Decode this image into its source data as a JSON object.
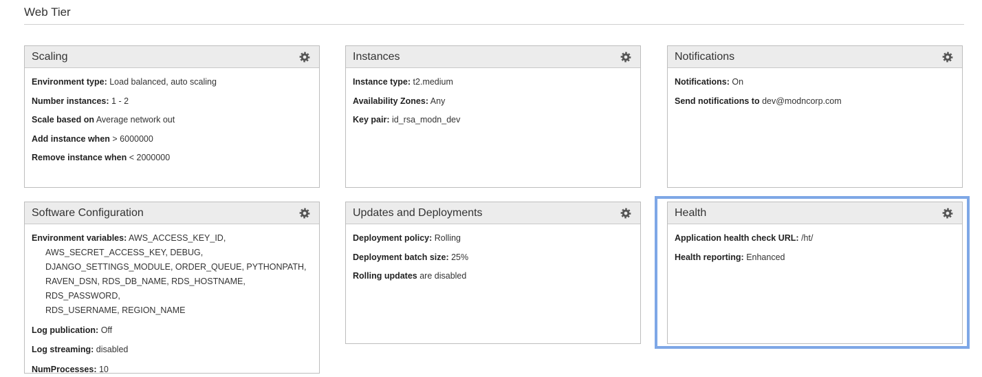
{
  "section": {
    "title": "Web Tier"
  },
  "highlight_color": "#7ea7e6",
  "cards": {
    "scaling": {
      "title": "Scaling",
      "icon": "gear-icon",
      "rows": [
        {
          "label": "Environment type:",
          "value": "Load balanced, auto scaling"
        },
        {
          "label": "Number instances:",
          "value": "1 - 2"
        },
        {
          "label": "Scale based on",
          "value": "Average network out"
        },
        {
          "label": "Add instance when",
          "value": "> 6000000"
        },
        {
          "label": "Remove instance when",
          "value": "< 2000000"
        }
      ]
    },
    "instances": {
      "title": "Instances",
      "icon": "gear-icon",
      "rows": [
        {
          "label": "Instance type:",
          "value": "t2.medium"
        },
        {
          "label": "Availability Zones:",
          "value": "Any"
        },
        {
          "label": "Key pair:",
          "value": "id_rsa_modn_dev"
        }
      ]
    },
    "notifications": {
      "title": "Notifications",
      "icon": "gear-icon",
      "rows": [
        {
          "label": "Notifications:",
          "value": "On"
        },
        {
          "label": "Send notifications to",
          "value": "dev@modncorp.com"
        }
      ]
    },
    "software": {
      "title": "Software Configuration",
      "icon": "gear-icon",
      "env": {
        "label": "Environment variables:",
        "lines": [
          "AWS_ACCESS_KEY_ID,",
          "AWS_SECRET_ACCESS_KEY, DEBUG,",
          "DJANGO_SETTINGS_MODULE, ORDER_QUEUE, PYTHONPATH,",
          "RAVEN_DSN, RDS_DB_NAME, RDS_HOSTNAME, RDS_PASSWORD,",
          "RDS_USERNAME, REGION_NAME"
        ]
      },
      "rows": [
        {
          "label": "Log publication:",
          "value": "Off"
        },
        {
          "label": "Log streaming:",
          "value": "disabled"
        },
        {
          "label": "NumProcesses:",
          "value": "10"
        }
      ]
    },
    "updates": {
      "title": "Updates and Deployments",
      "icon": "gear-icon",
      "rows": [
        {
          "label": "Deployment policy:",
          "value": "Rolling"
        },
        {
          "label": "Deployment batch size:",
          "value": "25%"
        },
        {
          "label": "Rolling updates",
          "value": "are disabled"
        }
      ]
    },
    "health": {
      "title": "Health",
      "icon": "gear-icon",
      "rows": [
        {
          "label": "Application health check URL:",
          "value": "/ht/"
        },
        {
          "label": "Health reporting:",
          "value": "Enhanced"
        }
      ]
    }
  }
}
